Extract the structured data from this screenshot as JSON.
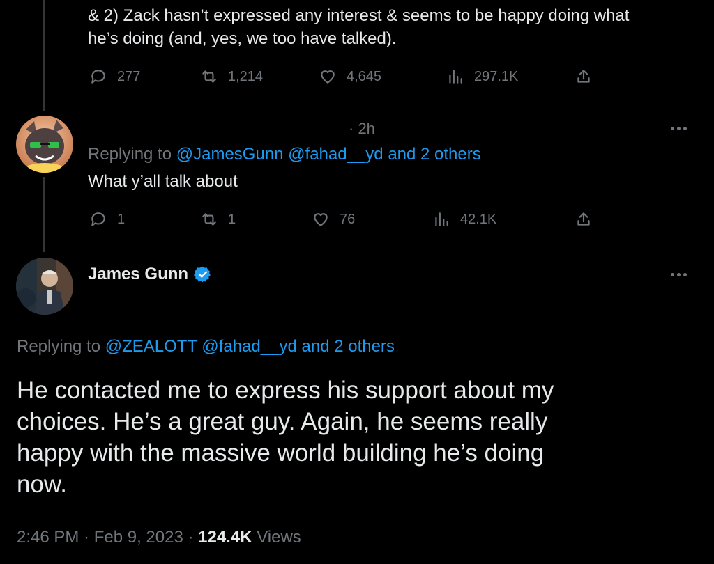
{
  "tweet1": {
    "text_line1": "& 2) Zack hasn’t expressed any interest & seems to be happy doing what",
    "text_line2": "he’s doing (and, yes, we too have talked).",
    "actions": {
      "replies": "277",
      "retweets": "1,214",
      "likes": "4,645",
      "views": "297.1K"
    }
  },
  "tweet2": {
    "time": "· 2h",
    "replying_prefix": "Replying to",
    "replying_handles": "@JamesGunn @fahad__yd and 2 others",
    "text": "What y’all talk about",
    "actions": {
      "replies": "1",
      "retweets": "1",
      "likes": "76",
      "views": "42.1K"
    }
  },
  "tweet3": {
    "author_name": "James Gunn",
    "replying_prefix": "Replying to",
    "replying_handles": "@ZEALOTT @fahad__yd and 2 others",
    "text_line1": "He contacted me to express his support about my",
    "text_line2": "choices. He’s a great guy. Again, he seems really",
    "text_line3": "happy with the massive world building he’s doing",
    "text_line4": "now.",
    "timestamp": "2:46 PM · Feb 9, 2023 ·",
    "views_count": "124.4K",
    "views_label": "Views"
  },
  "icons": {
    "reply": "reply-icon",
    "retweet": "retweet-icon",
    "like": "heart-icon",
    "views": "views-icon",
    "share": "share-icon",
    "more": "more-icon",
    "verified": "verified-badge-icon"
  },
  "colors": {
    "background": "#000000",
    "text": "#e7e9ea",
    "muted": "#71767b",
    "link": "#1d9bf0"
  }
}
